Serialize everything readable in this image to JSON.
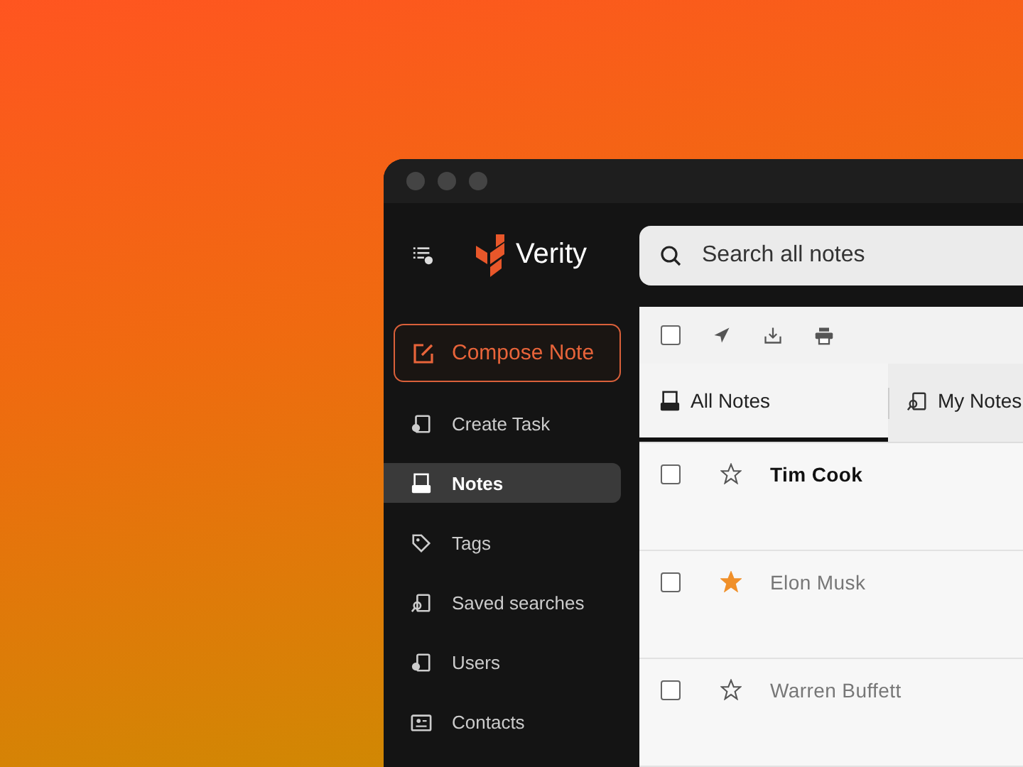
{
  "app": {
    "name": "Verity"
  },
  "search": {
    "placeholder": "Search all notes"
  },
  "compose_button": "Compose Note",
  "sidebar": {
    "items": [
      {
        "label": "Create Task",
        "selected": false
      },
      {
        "label": "Notes",
        "selected": true
      },
      {
        "label": "Tags",
        "selected": false
      },
      {
        "label": "Saved searches",
        "selected": false
      },
      {
        "label": "Users",
        "selected": false
      },
      {
        "label": "Contacts",
        "selected": false
      }
    ]
  },
  "toolbar": {
    "select_all": {
      "checked": false
    }
  },
  "tabs": [
    {
      "label": "All Notes",
      "selected": true
    },
    {
      "label": "My Notes",
      "selected": false
    }
  ],
  "notes": [
    {
      "title": "Tim Cook",
      "checked": false,
      "starred": false,
      "unread": true
    },
    {
      "title": "Elon Musk",
      "checked": false,
      "starred": true,
      "unread": false
    },
    {
      "title": "Warren Buffett",
      "checked": false,
      "starred": false,
      "unread": false
    }
  ]
}
